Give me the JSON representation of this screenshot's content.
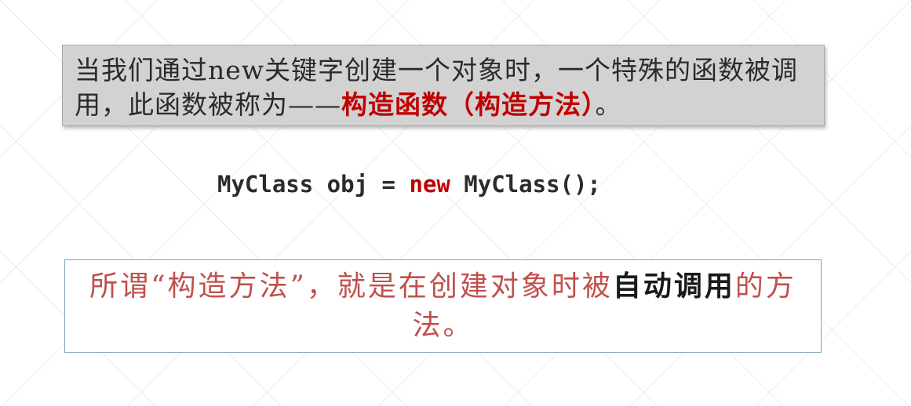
{
  "intro": {
    "prefix": "当我们通过new关键字创建一个对象时，一个特殊的函数被调用，此函数被称为——",
    "highlight": "构造函数（构造方法）",
    "suffix": "。"
  },
  "code": {
    "before": "MyClass obj = ",
    "keyword": "new",
    "after": " MyClass();"
  },
  "definition": {
    "part1": "所谓“构造方法”，就是在创建对象时被",
    "part2": "自动调用",
    "part3": "的方法。"
  },
  "colors": {
    "highlight_red": "#c00000",
    "definition_red": "#c0504d",
    "box_gray": "#d2d2d2",
    "box_border_blue": "#7aa6b4"
  }
}
